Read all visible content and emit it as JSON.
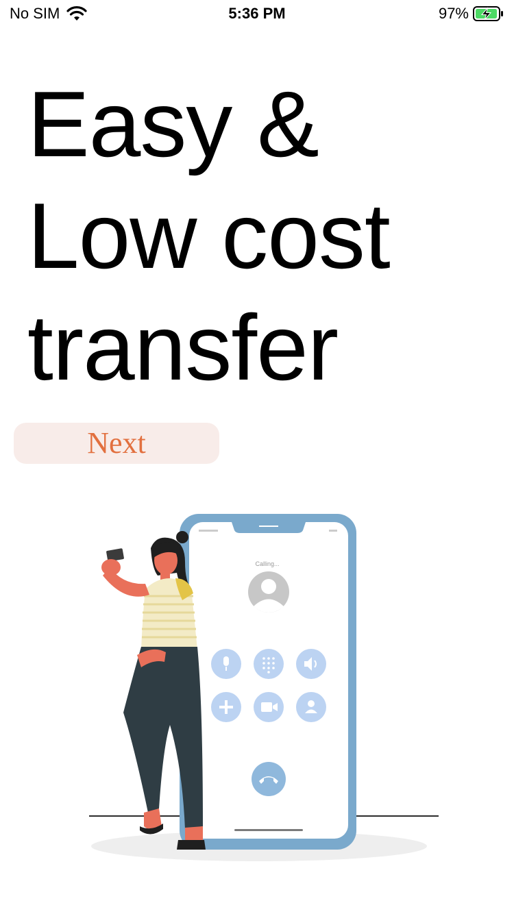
{
  "status_bar": {
    "carrier": "No SIM",
    "time": "5:36 PM",
    "battery_percent": "97%",
    "battery_level": 0.97
  },
  "headline": {
    "line1": "Easy &",
    "line2": "Low cost",
    "line3": "transfer"
  },
  "next_button": {
    "label": "Next"
  },
  "illustration": {
    "call_status": "Calling..."
  },
  "colors": {
    "accent": "#e2703f",
    "button_bg": "#f8ece9",
    "phone_frame": "#7aa9cc",
    "call_button": "#bcd3f2",
    "battery_green": "#4cd964"
  }
}
